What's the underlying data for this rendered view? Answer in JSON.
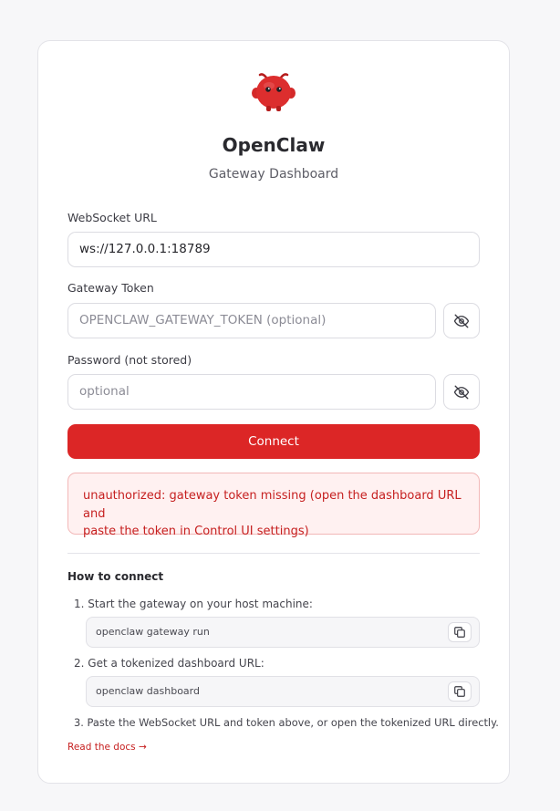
{
  "app": {
    "title": "OpenClaw",
    "subtitle": "Gateway Dashboard",
    "logo_icon": "red-claw-mascot-icon"
  },
  "form": {
    "ws_url": {
      "label": "WebSocket URL",
      "value": "ws://127.0.0.1:18789"
    },
    "token": {
      "label": "Gateway Token",
      "placeholder": "OPENCLAW_GATEWAY_TOKEN (optional)",
      "toggle_icon": "eye-off-icon"
    },
    "password": {
      "label": "Password (not stored)",
      "placeholder": "optional",
      "toggle_icon": "eye-off-icon"
    },
    "connect_label": "Connect"
  },
  "error": {
    "line1": "unauthorized: gateway token missing (open the dashboard URL and",
    "line2": "paste the token in Control UI settings)"
  },
  "howto": {
    "title": "How to connect",
    "steps": [
      {
        "text": "1. Start the gateway on your host machine:",
        "command": "openclaw gateway run"
      },
      {
        "text": "2. Get a tokenized dashboard URL:",
        "command": "openclaw dashboard"
      },
      {
        "text": "3. Paste the WebSocket URL and token above, or open the tokenized URL directly."
      }
    ],
    "docs_link": "Read the docs →"
  },
  "colors": {
    "accent": "#dc2626",
    "error_bg": "#fff1f1",
    "error_border": "#f2b8b8",
    "background": "#f7f7f9"
  }
}
